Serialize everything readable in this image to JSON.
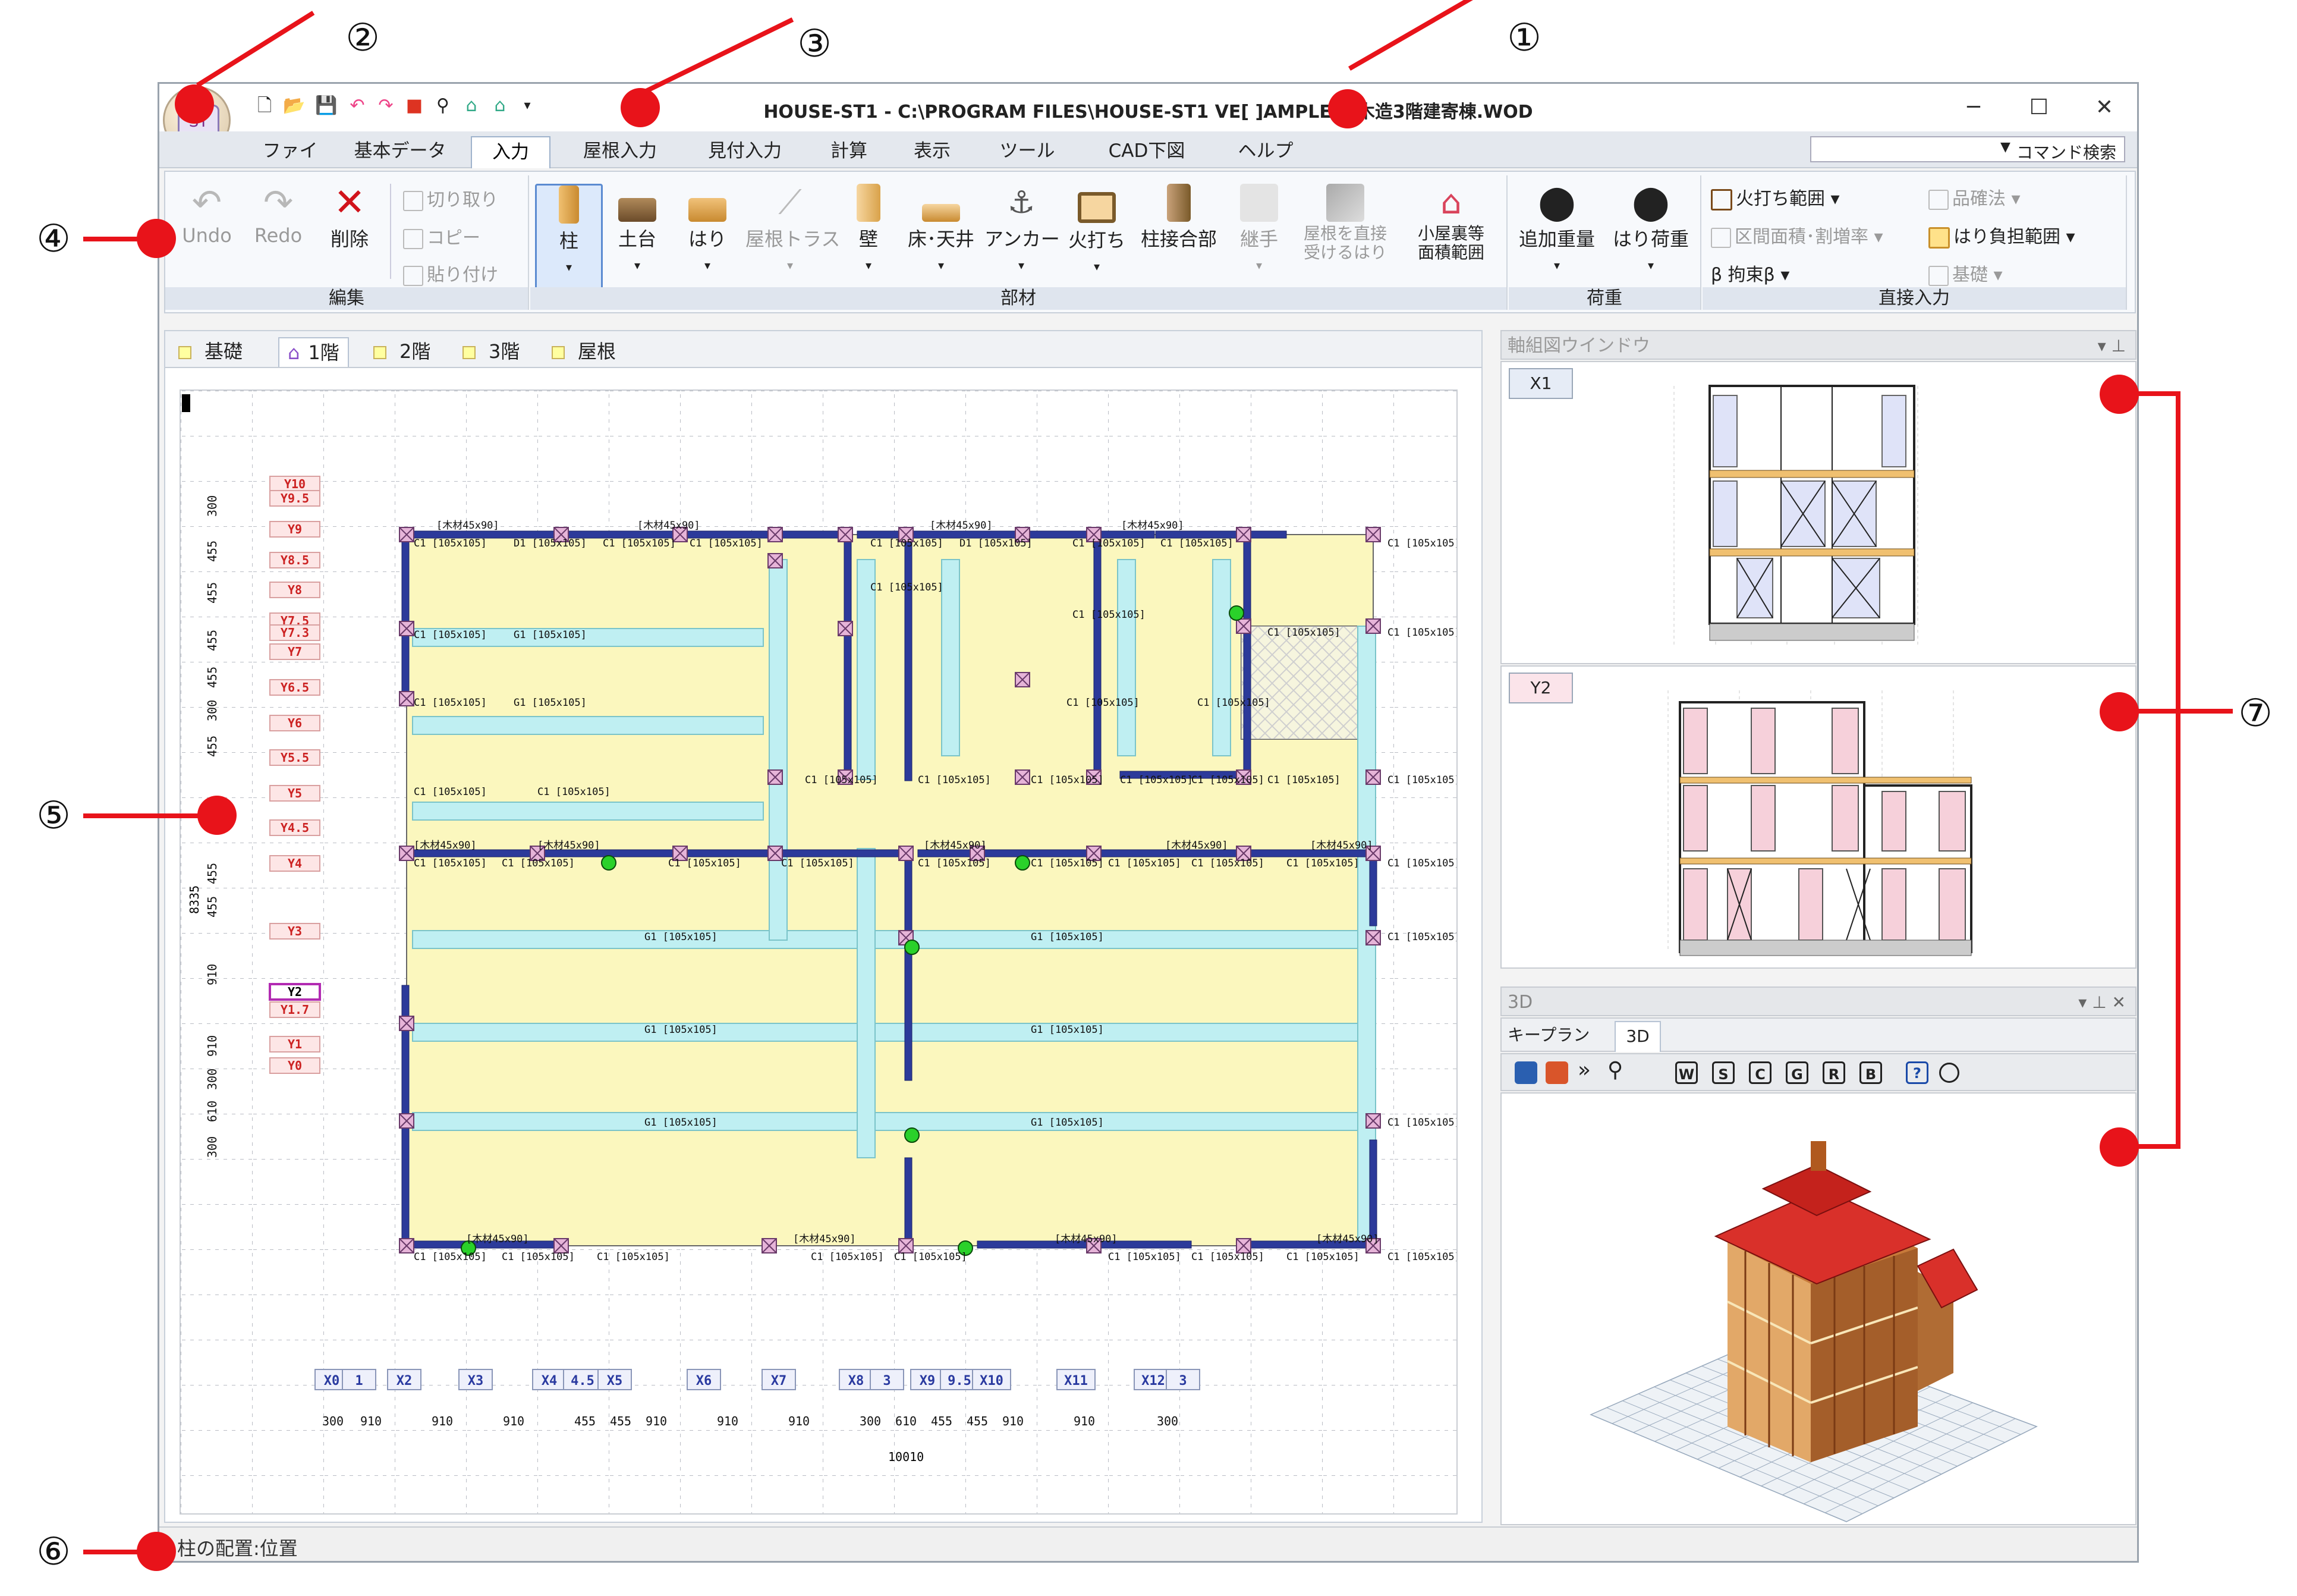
{
  "window": {
    "title": "HOUSE-ST1 - C:\\PROGRAM FILES\\HOUSE-ST1 VE[ ]AMPLES\\ 木造3階建寄棟.WOD",
    "controls": [
      "─",
      "☐",
      "✕"
    ]
  },
  "app_button": {
    "label": "ST"
  },
  "menu": {
    "tabs": [
      "ファイル",
      "基本データ",
      "入力",
      "屋根入力",
      "見付入力",
      "計算",
      "表示",
      "ツール",
      "CAD下図",
      "ヘルプ"
    ],
    "active": "入力",
    "command_search": "コマンド検索"
  },
  "ribbon": {
    "edit": {
      "label": "編集",
      "undo": "Undo",
      "redo": "Redo",
      "delete": "削除",
      "cut": "切り取り",
      "copy": "コピー",
      "paste": "貼り付け"
    },
    "members": {
      "label": "部材",
      "buttons": [
        "柱",
        "土台",
        "はり",
        "屋根トラス",
        "壁",
        "床･天井",
        "アンカー",
        "火打ち",
        "柱接合部",
        "継手",
        "屋根を直接\n受けるはり",
        "小屋裏等\n面積範囲"
      ]
    },
    "loads": {
      "label": "荷重",
      "buttons": [
        "追加重量",
        "はり荷重"
      ]
    },
    "direct": {
      "label": "直接入力",
      "items": [
        "火打ち範囲",
        "区間面積･割増率",
        "β 拘束β",
        "品確法",
        "はり負担範囲",
        "基礎"
      ]
    }
  },
  "floor_tabs": [
    "基礎",
    "1階",
    "2階",
    "3階",
    "屋根"
  ],
  "floor_active": "1階",
  "plan": {
    "y_labels": [
      "Y10",
      "Y9.5",
      "Y9",
      "Y8.5",
      "Y8",
      "Y7.5",
      "Y7.3",
      "Y7",
      "Y6.5",
      "Y6",
      "Y5.5",
      "Y5",
      "Y4.5",
      "Y4",
      "Y3",
      "Y2",
      "Y1.7",
      "Y1",
      "Y0"
    ],
    "y_dims": [
      "300",
      "455",
      "455",
      "455",
      "455",
      "300",
      "455",
      "455",
      "455",
      "455",
      "910",
      "910",
      "300",
      "610",
      "300"
    ],
    "y_total": "8335",
    "x_labels": [
      "X0",
      "1",
      "X2",
      "X3",
      "X4",
      "4.5",
      "X5",
      "X6",
      "X7",
      "X8",
      "3",
      "X9",
      "9.5",
      "X10",
      "X11",
      "X12",
      "3"
    ],
    "x_dims": [
      "300",
      "910",
      "910",
      "910",
      "455",
      "455",
      "910",
      "910",
      "910",
      "300",
      "610",
      "455",
      "455",
      "910",
      "910",
      "300"
    ],
    "x_total": "10010",
    "member_tag": "[木材45x90]",
    "col_tag": "C1 [105x105]",
    "beam_tag": "G1 [105x105]",
    "sill_tag": "D1 [105x105]"
  },
  "axis_window": {
    "title": "軸組図ウインドウ",
    "x1": "X1",
    "y2": "Y2"
  },
  "threed": {
    "title": "3D",
    "tabs": [
      "キープラン",
      "3D"
    ],
    "toolbar": [
      "W",
      "S",
      "C",
      "G",
      "R",
      "B",
      "?"
    ]
  },
  "status": "柱の配置:位置",
  "callouts": [
    "①",
    "②",
    "③",
    "④",
    "⑤",
    "⑥",
    "⑦"
  ],
  "colors": {
    "callout": "#e8131a",
    "floor": "#fbf7be",
    "beam": "#bfeff2",
    "wall": "#2c3a9a",
    "column": "#e6b4d8"
  }
}
